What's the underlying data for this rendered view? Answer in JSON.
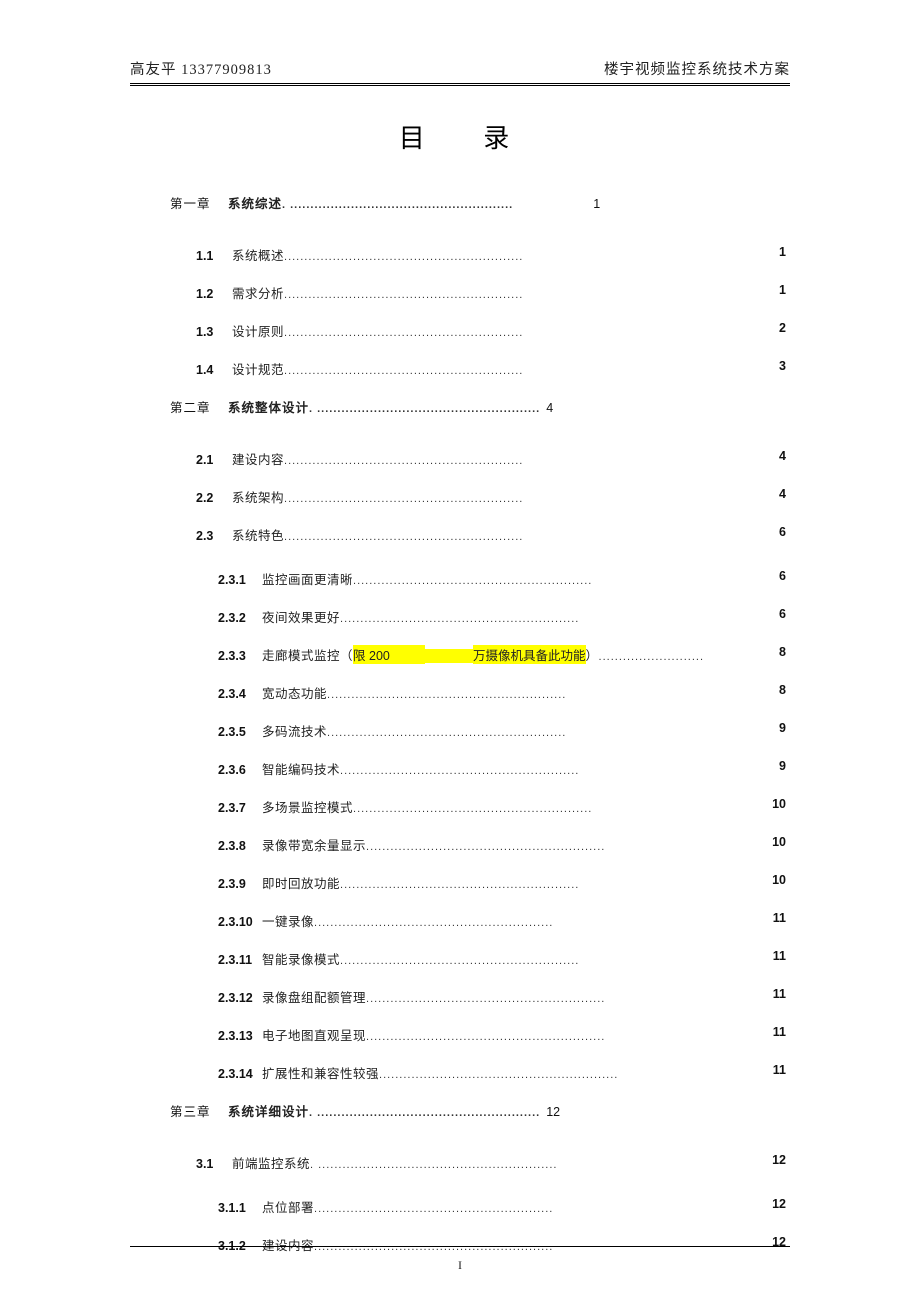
{
  "header": {
    "left": "高友平  13377909813",
    "right": "楼宇视频监控系统技术方案"
  },
  "title": "目  录",
  "dots_short": " ...........................................................",
  "dots_mid": " ....................................................",
  "dots_long": " .......................................................... ",
  "toc": [
    {
      "level": "chapter",
      "idx": "第一章",
      "label": "系统综述",
      "page": "1",
      "inline": true
    },
    {
      "level": "1",
      "idx": "1.1",
      "label": "系统概述",
      "page": "1"
    },
    {
      "level": "1",
      "idx": "1.2",
      "label": "需求分析",
      "page": "1"
    },
    {
      "level": "1",
      "idx": "1.3",
      "label": "设计原则",
      "page": "2"
    },
    {
      "level": "1",
      "idx": "1.4",
      "label": "设计规范",
      "page": "3"
    },
    {
      "level": "chapter",
      "idx": "第二章",
      "label": " 系统整体设计",
      "page": "4",
      "inline": true
    },
    {
      "level": "1",
      "idx": "2.1",
      "label": "建设内容",
      "page": "4"
    },
    {
      "level": "1",
      "idx": "2.2",
      "label": "系统架构",
      "page": "4"
    },
    {
      "level": "1",
      "idx": "2.3",
      "label": "系统特色",
      "page": "6"
    },
    {
      "level": "2",
      "idx": "2.3.1",
      "label": "监控画面更清晰",
      "page": "6"
    },
    {
      "level": "2",
      "idx": "2.3.2",
      "label": "夜间效果更好",
      "page": "6"
    },
    {
      "level": "2",
      "idx": "2.3.3",
      "label": "走廊模式监控（",
      "hl1": "限 200",
      "hl2": "万摄像机具备此功能",
      "tail": "）",
      "page": "8",
      "special": true
    },
    {
      "level": "2",
      "idx": "2.3.4",
      "label": "宽动态功能",
      "page": "8"
    },
    {
      "level": "2",
      "idx": "2.3.5",
      "label": "多码流技术",
      "page": "9"
    },
    {
      "level": "2",
      "idx": "2.3.6",
      "label": "智能编码技术",
      "page": "9"
    },
    {
      "level": "2",
      "idx": "2.3.7",
      "label": "多场景监控模式",
      "page": "10"
    },
    {
      "level": "2",
      "idx": "2.3.8",
      "label": "录像带宽余量显示",
      "page": "10"
    },
    {
      "level": "2",
      "idx": "2.3.9",
      "label": "即时回放功能",
      "page": "10"
    },
    {
      "level": "2",
      "idx": "2.3.10",
      "label": "一键录像",
      "page": "11"
    },
    {
      "level": "2",
      "idx": "2.3.11",
      "label": "智能录像模式",
      "page": "11"
    },
    {
      "level": "2",
      "idx": "2.3.12",
      "label": "录像盘组配额管理",
      "page": "11"
    },
    {
      "level": "2",
      "idx": "2.3.13",
      "label": "电子地图直观呈现",
      "page": "11"
    },
    {
      "level": "2",
      "idx": "2.3.14",
      "label": "扩展性和兼容性较强",
      "page": "11"
    },
    {
      "level": "chapter",
      "idx": "第三章",
      "label": " 系统详细设计",
      "page": "12",
      "inline": true
    },
    {
      "level": "1",
      "idx": "3.1",
      "label": "前端监控系统",
      "page": "12",
      "longdots": true
    },
    {
      "level": "2",
      "idx": "3.1.1",
      "label": "点位部署",
      "page": "12"
    },
    {
      "level": "2",
      "idx": "3.1.2",
      "label": "建设内容",
      "page": "12"
    }
  ],
  "footer": {
    "page_number": "I"
  }
}
